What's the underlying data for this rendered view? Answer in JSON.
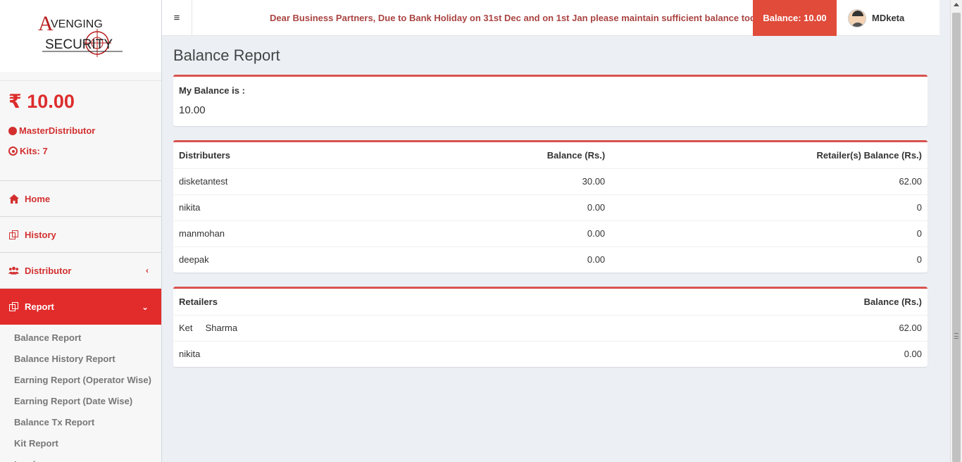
{
  "sidebar": {
    "logo_text_top": "VENGING",
    "logo_letter": "A",
    "logo_text_bottom": "SECURITY",
    "wallet_amount": "₹ 10.00",
    "role": "MasterDistributor",
    "kits": "Kits: 7",
    "nav": {
      "home": "Home",
      "history": "History",
      "distributor": "Distributor",
      "report": "Report"
    },
    "report_items": [
      "Balance Report",
      "Balance History Report",
      "Earning Report (Operator Wise)",
      "Earning Report (Date Wise)",
      "Balance Tx Report",
      "Kit Report",
      "Invoice"
    ]
  },
  "header": {
    "notice": "Dear Business Partners, Due to Bank Holiday on 31st Dec and on 1st Jan please maintain sufficient balance today",
    "balance_badge": "Balance: 10.00",
    "username": "MDketa"
  },
  "page": {
    "title": "Balance Report",
    "my_balance_label": "My Balance is :",
    "my_balance_value": "10.00"
  },
  "distributors_table": {
    "headers": [
      "Distributers",
      "Balance (Rs.)",
      "Retailer(s) Balance (Rs.)"
    ],
    "rows": [
      [
        "disketantest",
        "30.00",
        "62.00"
      ],
      [
        "nikita",
        "0.00",
        "0"
      ],
      [
        "manmohan",
        "0.00",
        "0"
      ],
      [
        "deepak",
        "0.00",
        "0"
      ]
    ]
  },
  "retailers_table": {
    "headers": [
      "Retailers",
      "Balance (Rs.)"
    ],
    "rows": [
      [
        "Ket     Sharma",
        "62.00"
      ],
      [
        "nikita",
        "0.00"
      ]
    ]
  },
  "colors": {
    "accent": "#e22b2b",
    "badge": "#e04b3a",
    "notice": "#a94442"
  }
}
